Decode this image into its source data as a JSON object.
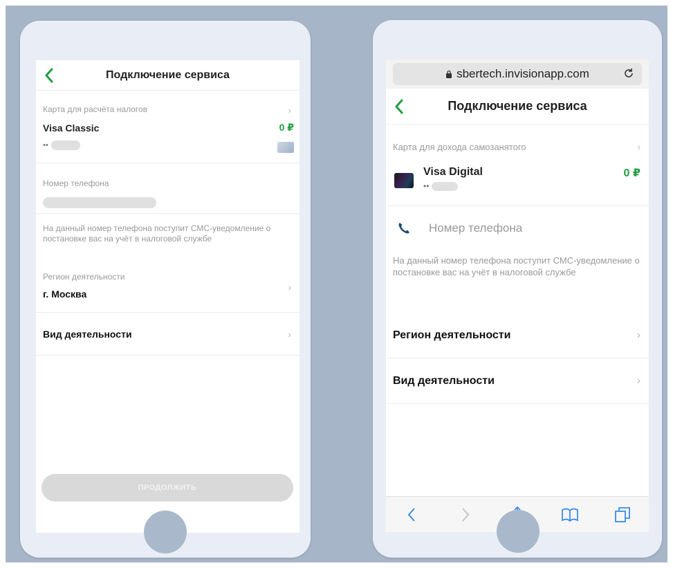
{
  "left": {
    "nav": {
      "title": "Подключение сервиса"
    },
    "card": {
      "caption": "Карта для расчёта налогов",
      "name": "Visa Classic",
      "balance": "0 ₽",
      "mask_prefix": "••"
    },
    "phone": {
      "caption": "Номер телефона"
    },
    "hint": "На данный номер телефона поступит СМС-уведомление о постановке вас на учёт в налоговой службе",
    "region": {
      "caption": "Регион деятельности",
      "value": "г. Москва"
    },
    "activity": {
      "label": "Вид деятельности"
    },
    "continue_label": "ПРОДОЛЖИТЬ"
  },
  "right": {
    "url": "sbertech.invisionapp.com",
    "nav": {
      "title": "Подключение сервиса"
    },
    "card": {
      "caption": "Карта для дохода самозанятого",
      "name": "Visa Digital",
      "balance": "0 ₽",
      "mask_prefix": "••"
    },
    "phone": {
      "placeholder": "Номер телефона"
    },
    "hint": "На данный номер телефона поступит СМС-уведомление о постановке вас на учёт в налоговой службе",
    "region": {
      "label": "Регион деятельности"
    },
    "activity": {
      "label": "Вид деятельности"
    }
  },
  "colors": {
    "accent": "#1f9e3f",
    "ios_blue": "#3a8ee6",
    "background": "#a6b6c8",
    "phone_frame": "#e9edf5"
  },
  "icons": [
    "back-chevron-icon",
    "chevron-right-icon",
    "lock-icon",
    "reload-icon",
    "phone-icon",
    "share-icon",
    "bookmarks-icon",
    "tabs-icon"
  ]
}
